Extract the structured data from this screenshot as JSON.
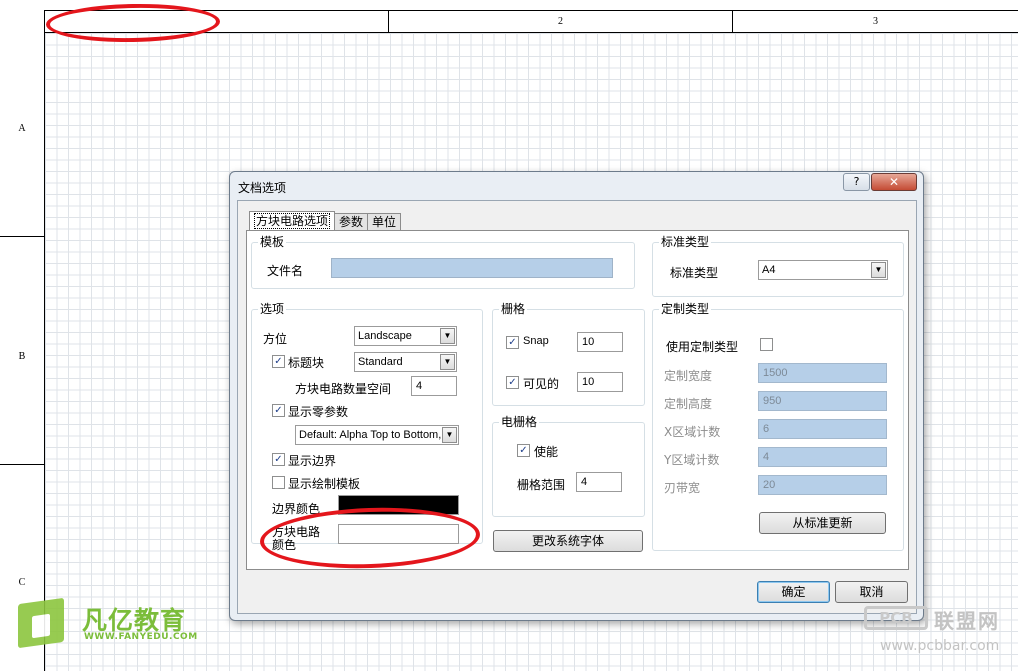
{
  "sheet": {
    "top_zones": [
      "1",
      "2",
      "3"
    ],
    "left_zones": [
      "A",
      "B",
      "C"
    ]
  },
  "dialog": {
    "title": "文档选项",
    "help_label": "?",
    "close_label": "✕",
    "tabs": [
      {
        "label": "方块电路选项",
        "active": true
      },
      {
        "label": "参数",
        "active": false
      },
      {
        "label": "单位",
        "active": false
      }
    ],
    "template": {
      "group_label": "模板",
      "file_label": "文件名",
      "file_value": ""
    },
    "options": {
      "group_label": "选项",
      "orientation_label": "方位",
      "orientation_value": "Landscape",
      "title_block_label": "标题块",
      "title_block_checked": true,
      "title_block_value": "Standard",
      "sheet_number_spaces_label": "方块电路数量空间",
      "sheet_number_spaces_value": "4",
      "show_zero_params_label": "显示零参数",
      "show_zero_params_checked": true,
      "default_order_value": "Default: Alpha Top to Bottom,",
      "show_border_label": "显示边界",
      "show_border_checked": true,
      "show_template_graphics_label": "显示绘制模板",
      "show_template_graphics_checked": false,
      "border_color_label": "边界颜色",
      "border_color": "#000000",
      "sheet_color_label": "方块电路\n颜色",
      "sheet_color": "#ffffff"
    },
    "grids": {
      "group_label": "栅格",
      "snap_label": "Snap",
      "snap_checked": true,
      "snap_value": "10",
      "visible_label": "可见的",
      "visible_checked": true,
      "visible_value": "10"
    },
    "electrical_grid": {
      "group_label": "电栅格",
      "enable_label": "使能",
      "enable_checked": true,
      "range_label": "栅格范围",
      "range_value": "4"
    },
    "change_font_button": "更改系统字体",
    "standard_style": {
      "group_label": "标准类型",
      "style_label": "标准类型",
      "style_value": "A4"
    },
    "custom_style": {
      "group_label": "定制类型",
      "use_custom_label": "使用定制类型",
      "use_custom_checked": false,
      "custom_width_label": "定制宽度",
      "custom_width_value": "1500",
      "custom_height_label": "定制高度",
      "custom_height_value": "950",
      "x_zones_label": "X区域计数",
      "x_zones_value": "6",
      "y_zones_label": "Y区域计数",
      "y_zones_value": "4",
      "margin_width_label": "刃带宽",
      "margin_width_value": "20",
      "update_from_standard_button": "从标准更新"
    },
    "ok_button": "确定",
    "cancel_button": "取消"
  },
  "watermarks": {
    "left_main": "凡亿教育",
    "left_sub": "WWW.FANYEDU.COM",
    "right_box": "PCB",
    "right_cn": "联盟网",
    "right_url": "www.pcbbar.com"
  },
  "colors": {
    "annotation_red": "#e4161c",
    "field_blue": "#b6cfe8",
    "logo_green": "#7bbd3a"
  }
}
